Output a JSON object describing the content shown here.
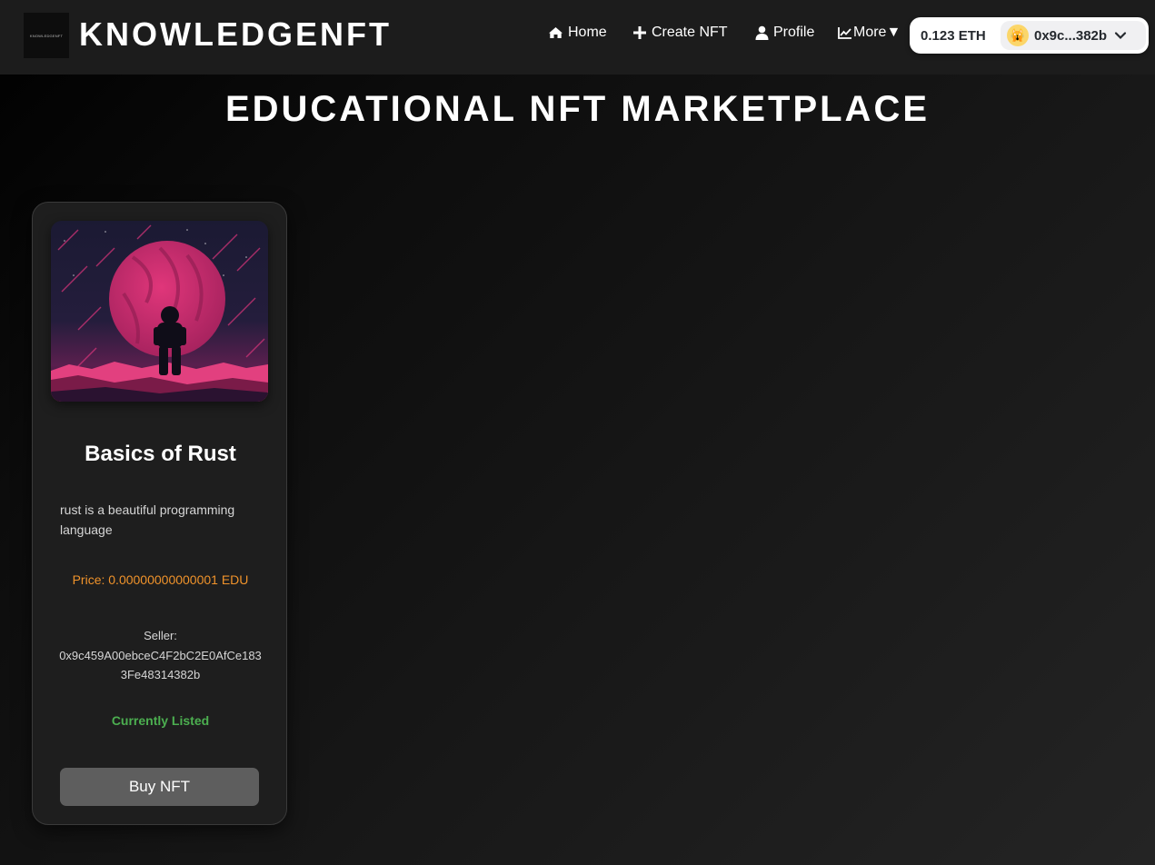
{
  "header": {
    "logo_text": "KNOWLEDGENFT",
    "brand": "KNOWLEDGENFT",
    "nav": {
      "home": "Home",
      "create": "Create NFT",
      "profile": "Profile",
      "more": "More▼"
    },
    "wallet": {
      "balance": "0.123 ETH",
      "account": "0x9c...382b",
      "avatar_emoji": "🙀"
    }
  },
  "main": {
    "title": "EDUCATIONAL NFT MARKETPLACE",
    "nfts": [
      {
        "title": "Basics of Rust",
        "description": "rust is a beautiful programming language",
        "price": "Price: 0.00000000000001 EDU",
        "seller_label": "Seller:",
        "seller_address": "0x9c459A00ebceC4F2bC2E0AfCe1833Fe48314382b",
        "status": "Currently Listed",
        "button": "Buy NFT"
      }
    ]
  },
  "colors": {
    "price": "#f0932b",
    "status_listed": "#4caf50",
    "button_bg": "#5e5e5e"
  }
}
